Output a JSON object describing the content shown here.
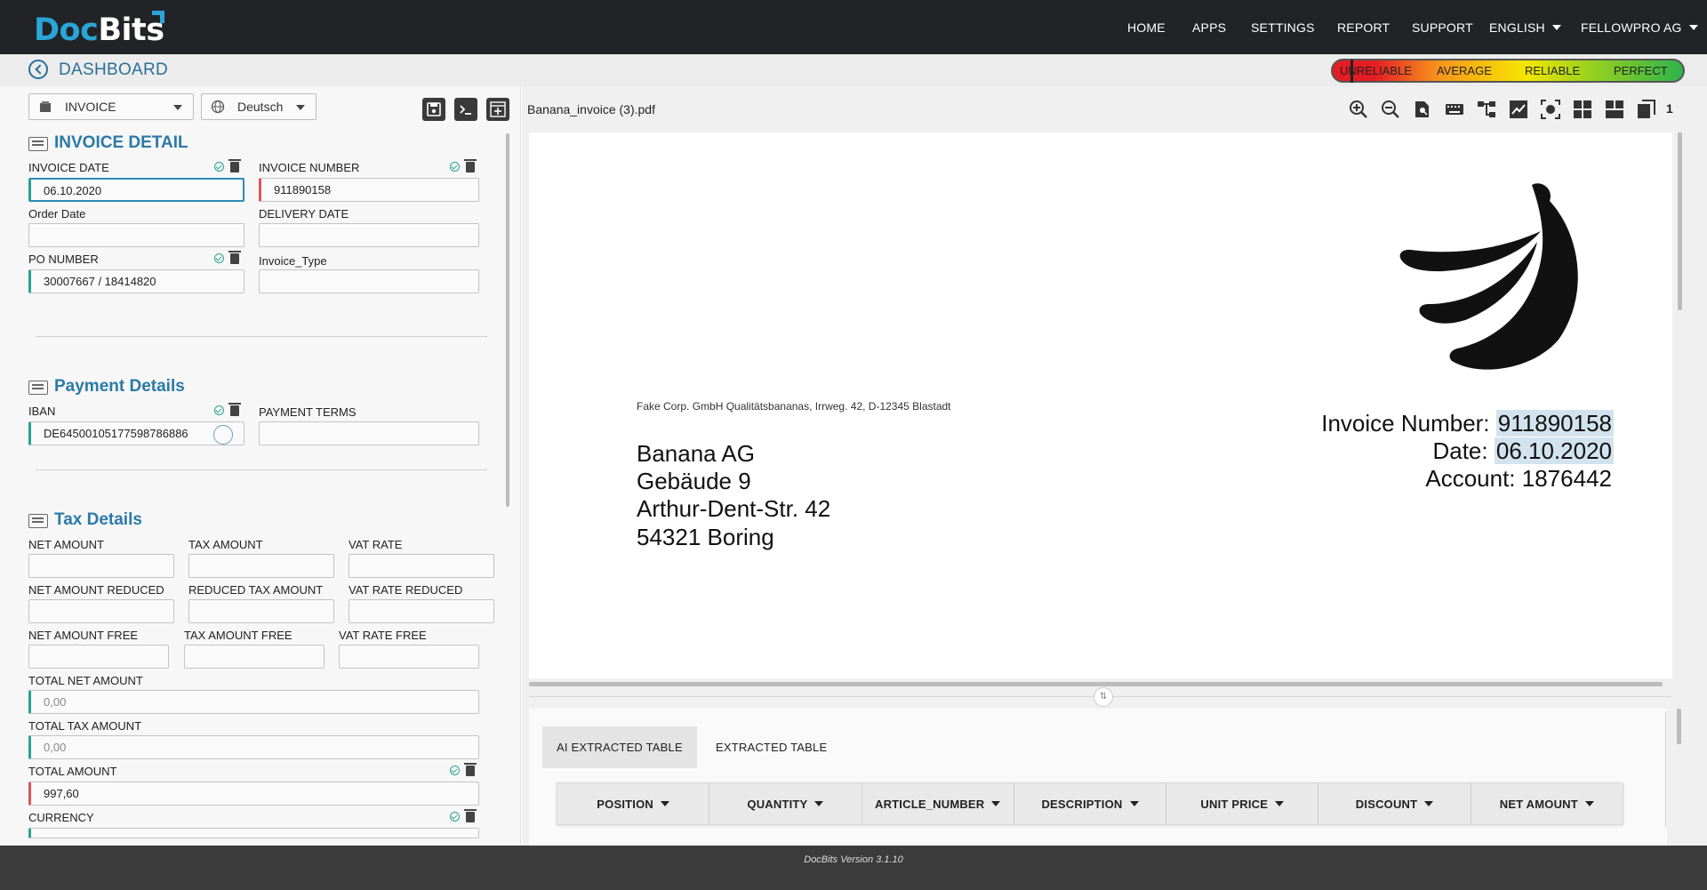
{
  "app": {
    "logo_part1": "Doc",
    "logo_part2": "Bits",
    "version": "DocBits Version 3.1.10"
  },
  "nav": {
    "home": "HOME",
    "apps": "APPS",
    "settings": "SETTINGS",
    "report": "REPORT",
    "support": "SUPPORT",
    "language": "ENGLISH",
    "company": "FELLOWPRO AG"
  },
  "subheader": {
    "title": "DASHBOARD",
    "reliability": {
      "unreliable": "UNRELIABLE",
      "average": "AVERAGE",
      "reliable": "RELIABLE",
      "perfect": "PERFECT"
    },
    "colors": {
      "red": "#e51c23",
      "orange": "#f7941d",
      "yellow": "#f5e600",
      "lime": "#9fd31c",
      "green": "#2db34a"
    }
  },
  "toolbar": {
    "doc_type": "INVOICE",
    "language": "Deutsch",
    "save_icon": "save-icon",
    "terminal_icon": "terminal-icon",
    "add_icon": "add-icon"
  },
  "sections": {
    "invoice_detail": {
      "title": "INVOICE DETAIL",
      "fields": {
        "invoice_date": {
          "label": "INVOICE DATE",
          "value": "06.10.2020"
        },
        "invoice_number": {
          "label": "INVOICE NUMBER",
          "value": "911890158"
        },
        "order_date": {
          "label": "Order Date",
          "value": ""
        },
        "delivery_date": {
          "label": "DELIVERY DATE",
          "value": ""
        },
        "po_number": {
          "label": "PO NUMBER",
          "value": "30007667 / 18414820"
        },
        "invoice_type": {
          "label": "Invoice_Type",
          "value": ""
        }
      }
    },
    "payment_details": {
      "title": "Payment Details",
      "fields": {
        "iban": {
          "label": "IBAN",
          "value": "DE64500105177598786886"
        },
        "payment_terms": {
          "label": "PAYMENT TERMS",
          "value": ""
        }
      }
    },
    "tax_details": {
      "title": "Tax Details",
      "fields": {
        "net_amount": {
          "label": "NET AMOUNT",
          "value": ""
        },
        "tax_amount": {
          "label": "TAX AMOUNT",
          "value": ""
        },
        "vat_rate": {
          "label": "VAT RATE",
          "value": ""
        },
        "net_amount_reduced": {
          "label": "NET AMOUNT REDUCED",
          "value": ""
        },
        "reduced_tax_amount": {
          "label": "REDUCED TAX AMOUNT",
          "value": ""
        },
        "vat_rate_reduced": {
          "label": "VAT RATE REDUCED",
          "value": ""
        },
        "net_amount_free": {
          "label": "NET AMOUNT FREE",
          "value": ""
        },
        "tax_amount_free": {
          "label": "TAX AMOUNT FREE",
          "value": ""
        },
        "vat_rate_free": {
          "label": "VAT RATE FREE",
          "value": ""
        },
        "total_net_amount": {
          "label": "TOTAL NET AMOUNT",
          "value": "0,00"
        },
        "total_tax_amount": {
          "label": "TOTAL TAX AMOUNT",
          "value": "0,00"
        },
        "total_amount": {
          "label": "TOTAL AMOUNT",
          "value": "997,60"
        },
        "currency": {
          "label": "CURRENCY",
          "value": ""
        }
      }
    }
  },
  "viewer": {
    "filename": "Banana_invoice (3).pdf",
    "page_count": "1",
    "document": {
      "sender_line": "Fake Corp. GmbH Qualitätsbananas, Irrweg. 42, D-12345 Blastadt",
      "address": [
        "Banana AG",
        "Gebäude 9",
        "Arthur-Dent-Str. 42",
        "54321 Boring"
      ],
      "invoice_number_label": "Invoice Number:",
      "invoice_number_value": "911890158",
      "date_label": "Date:",
      "date_value": "06.10.2020",
      "account_label": "Account:",
      "account_value": "1876442"
    }
  },
  "table": {
    "tabs": [
      "AI EXTRACTED TABLE",
      "EXTRACTED TABLE"
    ],
    "active_tab": "AI EXTRACTED TABLE",
    "columns": [
      "POSITION",
      "QUANTITY",
      "ARTICLE_NUMBER",
      "DESCRIPTION",
      "UNIT PRICE",
      "DISCOUNT",
      "NET AMOUNT"
    ]
  }
}
